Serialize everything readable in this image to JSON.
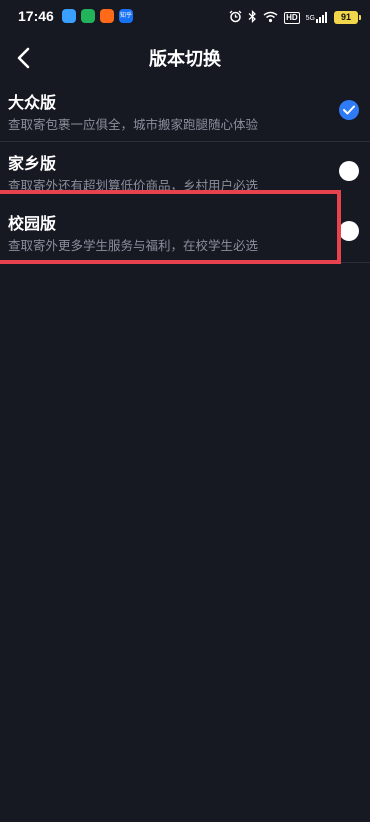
{
  "status_bar": {
    "time": "17:46",
    "app_icons": [
      "app-a",
      "app-b",
      "app-c",
      "知乎"
    ],
    "hd": "HD",
    "signal_label": "5G",
    "battery": "91"
  },
  "nav": {
    "title": "版本切换"
  },
  "options": [
    {
      "title": "大众版",
      "desc": "查取寄包裹一应俱全，城市搬家跑腿随心体验",
      "selected": true
    },
    {
      "title": "家乡版",
      "desc": "查取寄外还有超划算低价商品，乡村用户必选",
      "selected": false
    },
    {
      "title": "校园版",
      "desc": "查取寄外更多学生服务与福利，在校学生必选",
      "selected": false
    }
  ],
  "colors": {
    "background": "#161822",
    "accent": "#2f7af5",
    "highlight": "#e8424e"
  }
}
